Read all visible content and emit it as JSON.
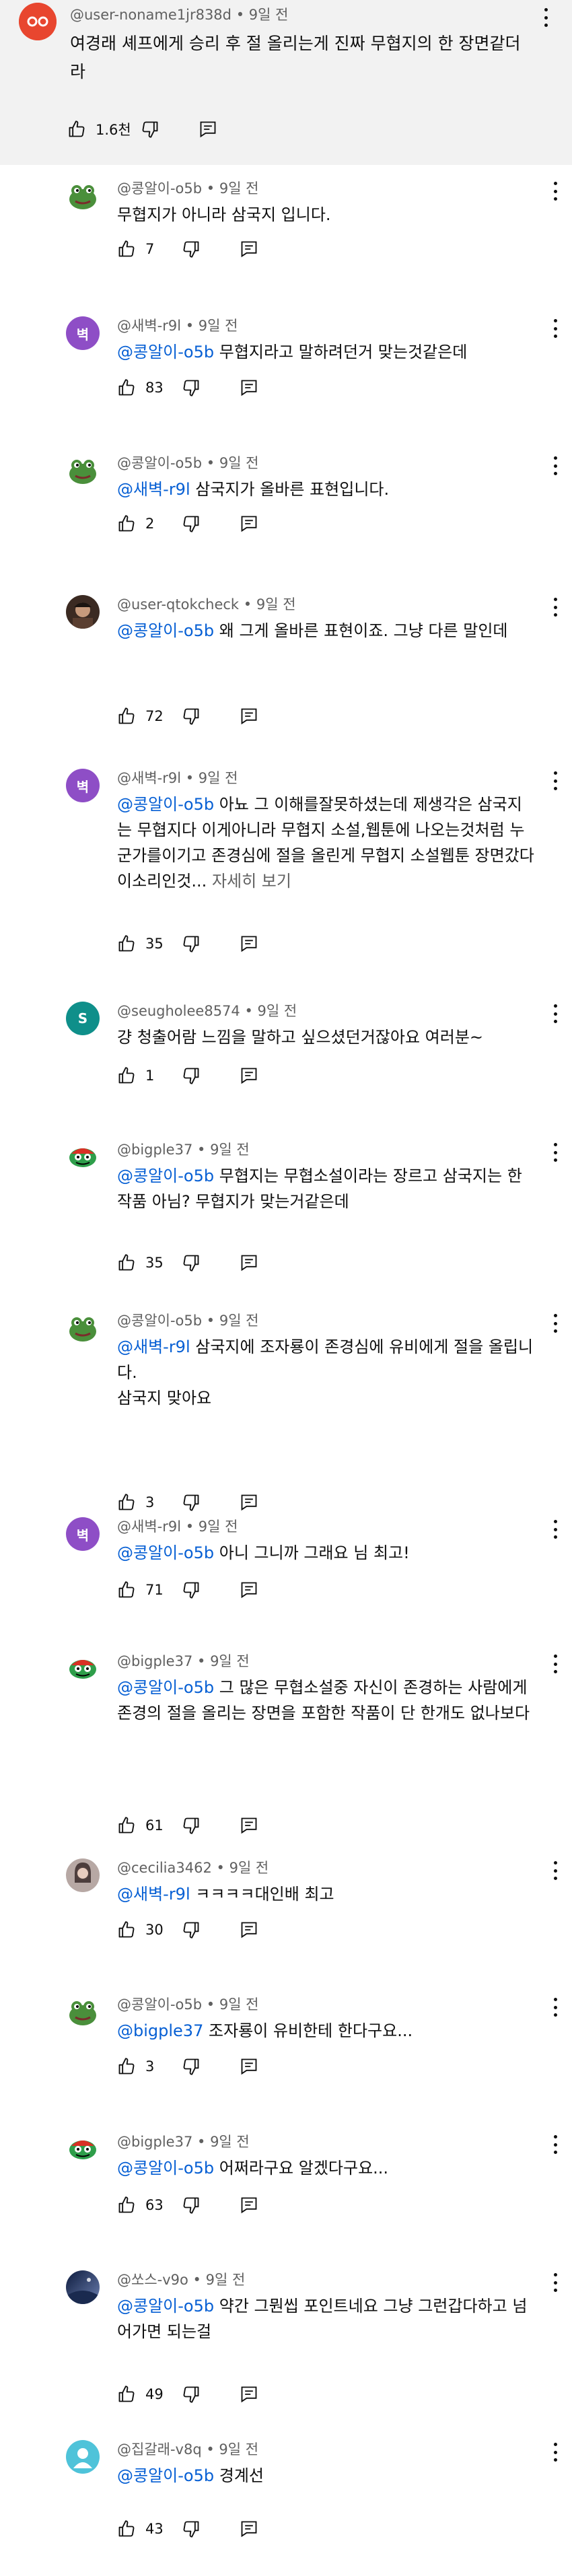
{
  "top_comment": {
    "author": "@user-noname1jr838d",
    "time": "9일 전",
    "text": "여경래 셰프에게 승리 후 절 올리는게 진짜 무협지의 한 장면같더라",
    "likes": "1.6천",
    "avatar_color": "#e8462f"
  },
  "replies": [
    {
      "author": "@콩알이-o5b",
      "time": "9일 전",
      "mention": "",
      "text": "무협지가 아니라 삼국지 입니다.",
      "more": "",
      "likes": "7",
      "avatar": "frog"
    },
    {
      "author": "@새벽-r9l",
      "time": "9일 전",
      "mention": "@콩알이-o5b",
      "text": "무협지라고 말하려던거 맞는것같은데",
      "more": "",
      "likes": "83",
      "avatar": "letter",
      "avatar_letter": "벽",
      "avatar_color": "#8e4ec6"
    },
    {
      "author": "@콩알이-o5b",
      "time": "9일 전",
      "mention": "@새벽-r9l",
      "text": "삼국지가 올바른 표현입니다.",
      "more": "",
      "likes": "2",
      "avatar": "frog"
    },
    {
      "author": "@user-qtokcheck",
      "time": "9일 전",
      "mention": "@콩알이-o5b",
      "text": "왜 그게 올바른 표현이죠. 그냥 다른 말인데",
      "more": "",
      "likes": "72",
      "avatar": "photo"
    },
    {
      "author": "@새벽-r9l",
      "time": "9일 전",
      "mention": "@콩알이-o5b",
      "text": "아뇨 그 이해를잘못하셨는데 제생각은 삼국지는 무협지다 이게아니라 무협지 소설,웹툰에 나오는것처럼 누군가를이기고 존경심에 절을 올린게 무협지 소설웹툰 장면갔다 이소리인것...",
      "more": "자세히 보기",
      "likes": "35",
      "avatar": "letter",
      "avatar_letter": "벽",
      "avatar_color": "#8e4ec6"
    },
    {
      "author": "@seugholee8574",
      "time": "9일 전",
      "mention": "",
      "text": "걍 청출어람 느낌을 말하고 싶으셨던거잖아요 여러분~",
      "more": "",
      "likes": "1",
      "avatar": "letter",
      "avatar_letter": "S",
      "avatar_color": "#0f8f8a"
    },
    {
      "author": "@bigple37",
      "time": "9일 전",
      "mention": "@콩알이-o5b",
      "text": "무협지는 무협소설이라는 장르고 삼국지는 한 작품 아님? 무협지가 맞는거같은데",
      "more": "",
      "likes": "35",
      "avatar": "cartoon"
    },
    {
      "author": "@콩알이-o5b",
      "time": "9일 전",
      "mention": "@새벽-r9l",
      "text": "삼국지에 조자룡이 존경심에 유비에게 절을 올립니다.\n삼국지 맞아요",
      "more": "",
      "likes": "3",
      "avatar": "frog"
    },
    {
      "author": "@새벽-r9l",
      "time": "9일 전",
      "mention": "@콩알이-o5b",
      "text": "아니 그니까 그래요 님 최고!",
      "more": "",
      "likes": "71",
      "avatar": "letter",
      "avatar_letter": "벽",
      "avatar_color": "#8e4ec6"
    },
    {
      "author": "@bigple37",
      "time": "9일 전",
      "mention": "@콩알이-o5b",
      "text": "그 많은 무협소설중 자신이 존경하는 사람에게 존경의 절을 올리는 장면을 포함한 작품이 단 한개도 없나보다",
      "more": "",
      "likes": "61",
      "avatar": "cartoon"
    },
    {
      "author": "@cecilia3462",
      "time": "9일 전",
      "mention": "@새벽-r9l",
      "text": "ㅋㅋㅋㅋ대인배 최고",
      "more": "",
      "likes": "30",
      "avatar": "photo2"
    },
    {
      "author": "@콩알이-o5b",
      "time": "9일 전",
      "mention": "@bigple37",
      "text": "조자룡이 유비한테 한다구요...",
      "more": "",
      "likes": "3",
      "avatar": "frog"
    },
    {
      "author": "@bigple37",
      "time": "9일 전",
      "mention": "@콩알이-o5b",
      "text": "어쩌라구요 알겠다구요...",
      "more": "",
      "likes": "63",
      "avatar": "cartoon"
    },
    {
      "author": "@쏘스-v9o",
      "time": "9일 전",
      "mention": "@콩알이-o5b",
      "text": "약간 그뭔씹 포인트네요 그냥 그런갑다하고 넘어가면 되는걸",
      "more": "",
      "likes": "49",
      "avatar": "photo3"
    },
    {
      "author": "@집갈래-v8q",
      "time": "9일 전",
      "mention": "@콩알이-o5b",
      "text": "경계선",
      "more": "",
      "likes": "43",
      "avatar": "person"
    }
  ]
}
